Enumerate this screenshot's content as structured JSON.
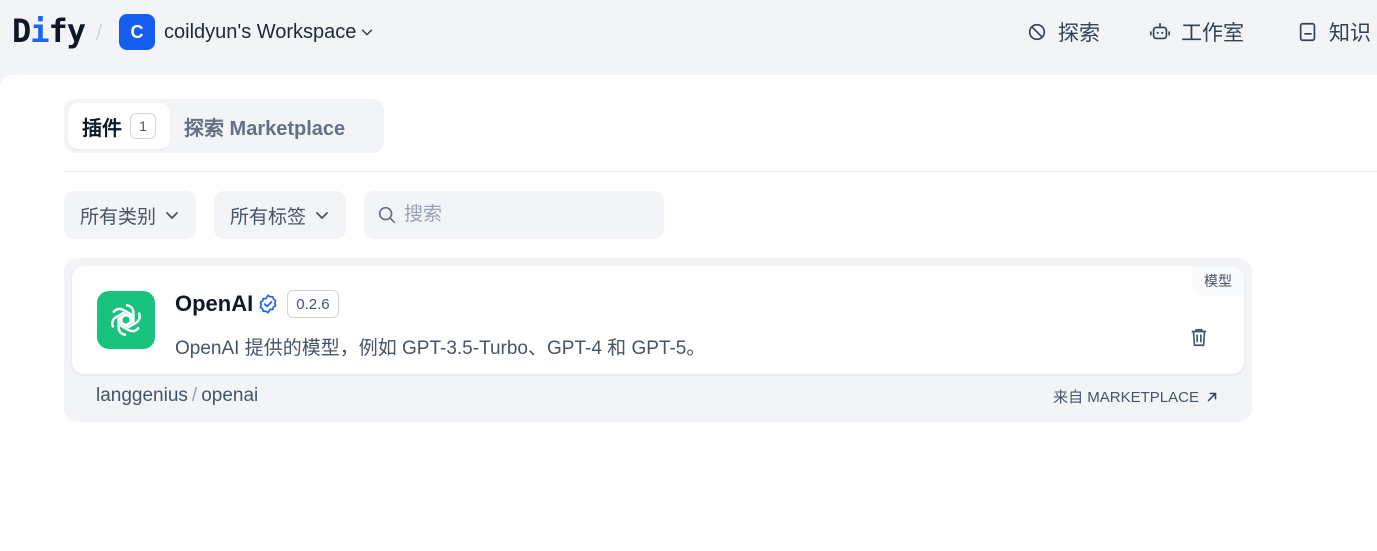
{
  "header": {
    "logo_prefix": "D",
    "logo_i": "i",
    "logo_suffix": "fy",
    "separator": "/",
    "workspace": {
      "avatar_letter": "C",
      "name": "coildyun's Workspace"
    },
    "nav": [
      {
        "label": "探索",
        "icon": "explore-icon"
      },
      {
        "label": "工作室",
        "icon": "robot-icon"
      },
      {
        "label": "知识",
        "icon": "book-icon"
      }
    ]
  },
  "tabs": {
    "active_label": "插件",
    "active_count": "1",
    "inactive_label": "探索 Marketplace"
  },
  "filters": {
    "category": "所有类别",
    "tags": "所有标签",
    "search_placeholder": "搜索"
  },
  "plugins": [
    {
      "name": "OpenAI",
      "version": "0.2.6",
      "tag": "模型",
      "description": "OpenAI 提供的模型，例如 GPT-3.5-Turbo、GPT-4 和 GPT-5。",
      "org": "langgenius",
      "org_sep": "/",
      "package": "openai",
      "source": "来自 MARKETPLACE",
      "icon_color": "#19c37d"
    }
  ],
  "colors": {
    "accent": "#155eef",
    "openai_green": "#19c37d",
    "background": "#f2f4f7"
  }
}
